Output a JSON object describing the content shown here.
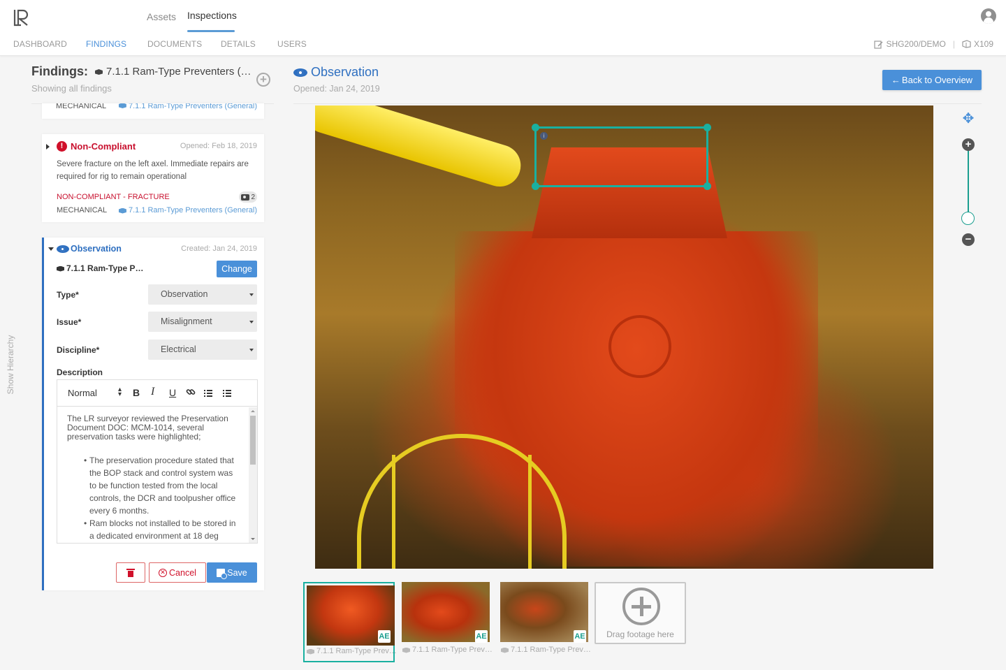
{
  "header": {
    "logo": "LR",
    "top_tabs": [
      {
        "label": "Assets",
        "active": false
      },
      {
        "label": "Inspections",
        "active": true
      }
    ],
    "sub_tabs": [
      {
        "label": "DASHBOARD",
        "active": false
      },
      {
        "label": "FINDINGS",
        "active": true
      },
      {
        "label": "DOCUMENTS",
        "active": false
      },
      {
        "label": "DETAILS",
        "active": false
      },
      {
        "label": "USERS",
        "active": false
      }
    ],
    "project": "SHG200/DEMO",
    "asset_code": "X109",
    "accent_color": "#4a90d9"
  },
  "sidebar_toggle": "Show Hierarchy",
  "findings_panel": {
    "title": "Findings:",
    "asset": "7.1.1 Ram-Type Preventers (…",
    "subtitle": "Showing all findings",
    "partial_card": {
      "discipline": "MECHANICAL",
      "asset": "7.1.1 Ram-Type Preventers (General)"
    },
    "non_compliant_card": {
      "type": "Non-Compliant",
      "date": "Opened: Feb 18, 2019",
      "description": "Severe fracture on the left axel. Immediate repairs are required for rig to remain operational",
      "tag": "NON-COMPLIANT - FRACTURE",
      "photo_count": "2",
      "discipline": "MECHANICAL",
      "asset": "7.1.1 Ram-Type Preventers (General)",
      "color": "#c8102e"
    },
    "observation_card": {
      "type": "Observation",
      "date": "Created: Jan 24, 2019",
      "asset": "7.1.1 Ram-Type P…",
      "change_label": "Change",
      "fields": {
        "type_label": "Type*",
        "type_value": "Observation",
        "issue_label": "Issue*",
        "issue_value": "Misalignment",
        "discipline_label": "Discipline*",
        "discipline_value": "Electrical"
      },
      "description_label": "Description",
      "editor": {
        "format": "Normal",
        "bold": "B",
        "italic": "I",
        "underline": "U"
      },
      "description_text": {
        "intro": "The LR surveyor reviewed the Preservation Document DOC: MCM-1014, several preservation tasks were highlighted;",
        "bullets": [
          "The preservation procedure stated that the BOP stack and control system was to be function tested from the local controls, the DCR and toolpusher office every 6 months.",
          "Ram blocks not installed to be stored in a dedicated environment at 18 deg"
        ]
      },
      "cancel_label": "Cancel",
      "save_label": "Save"
    }
  },
  "main": {
    "title": "Observation",
    "opened": "Opened: Jan 24, 2019",
    "back_label": "Back to Overview",
    "annotation_info": "i",
    "zoom_level": 0.05,
    "thumbnails": [
      {
        "caption": "7.1.1 Ram-Type Prev…",
        "badge": "AE",
        "selected": true
      },
      {
        "caption": "7.1.1 Ram-Type Prev…",
        "badge": "AE",
        "selected": false
      },
      {
        "caption": "7.1.1 Ram-Type Prev…",
        "badge": "AE",
        "selected": false
      }
    ],
    "drop_zone_label": "Drag footage here"
  }
}
